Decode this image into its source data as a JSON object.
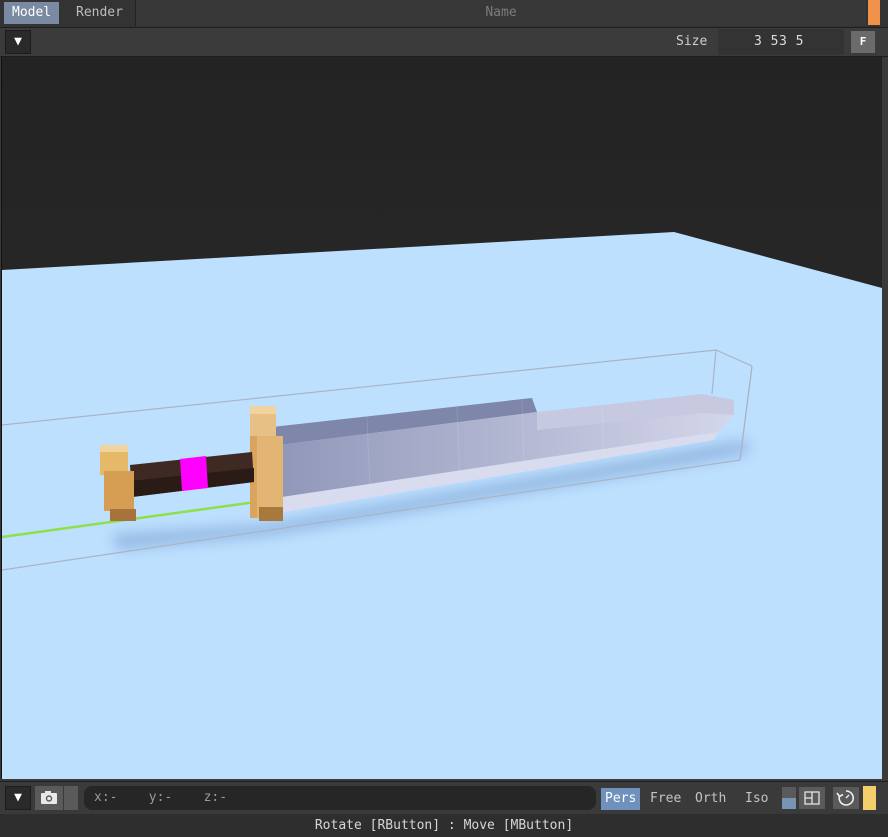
{
  "tabs": [
    {
      "label": "Model",
      "active": true
    },
    {
      "label": "Render",
      "active": false
    }
  ],
  "name_field": {
    "placeholder": "Name"
  },
  "toolbar": {
    "menu_glyph": "▼",
    "size_label": "Size",
    "size_value": "3 53 5",
    "fit_label": "F"
  },
  "bottom": {
    "menu_glyph": "▼",
    "camera_glyph": "📷",
    "coords": "x:-    y:-    z:-",
    "modes": [
      {
        "label": "Pers",
        "active": true
      },
      {
        "label": "Free",
        "active": false
      },
      {
        "label": "Orth",
        "active": false
      },
      {
        "label": "Iso",
        "active": false
      }
    ]
  },
  "status": "Rotate [RButton] : Move [MButton]",
  "colors": {
    "accent_orange": "#f0924a",
    "ground": "#bde0ff",
    "sky": "#232323",
    "handle_gem": "#ff00ff",
    "guard_gold": "#d9a55d",
    "blade": "#b3b8d6"
  }
}
